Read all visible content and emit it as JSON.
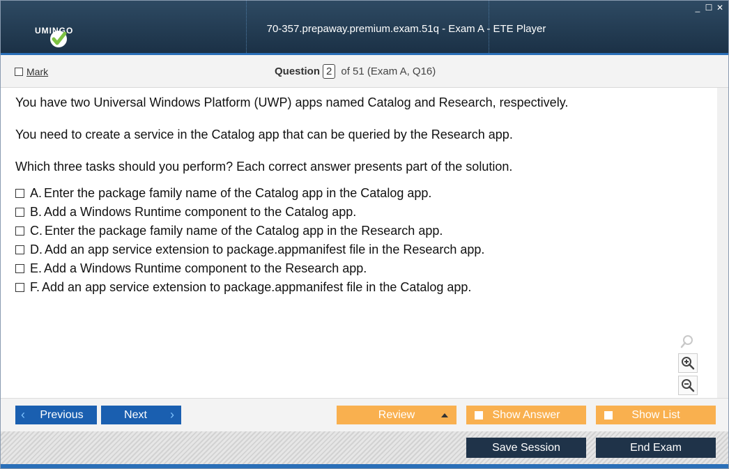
{
  "window": {
    "title": "70-357.prepaway.premium.exam.51q - Exam A - ETE Player",
    "logo_text": "UMINGO",
    "controls": [
      "_",
      "☐",
      "✕"
    ]
  },
  "header": {
    "mark_label": "Mark",
    "question_word": "Question",
    "question_number": "2",
    "question_of": "of 51 (Exam A, Q16)"
  },
  "question": {
    "paragraphs": [
      "You have two Universal Windows Platform (UWP) apps named Catalog and Research, respectively.",
      "You need to create a service in the Catalog app that can be queried by the Research app.",
      "Which three tasks should you perform? Each correct answer presents part of the solution."
    ],
    "options": [
      {
        "letter": "A.",
        "text": "Enter the package family name of the Catalog app in the Catalog app."
      },
      {
        "letter": "B.",
        "text": "Add a Windows Runtime component to the Catalog app."
      },
      {
        "letter": "C.",
        "text": "Enter the package family name of the Catalog app in the Research app."
      },
      {
        "letter": "D.",
        "text": "Add an app service extension to package.appmanifest file in the Research app."
      },
      {
        "letter": "E.",
        "text": "Add a Windows Runtime component to the Research app."
      },
      {
        "letter": "F.",
        "text": "Add an app service extension to package.appmanifest file in the Catalog app."
      }
    ]
  },
  "nav": {
    "previous": "Previous",
    "next": "Next",
    "review": "Review",
    "show_answer": "Show Answer",
    "show_list": "Show List",
    "save_session": "Save Session",
    "end_exam": "End Exam"
  },
  "colors": {
    "titlebar": "#1b3146",
    "accent_blue": "#1a5fb0",
    "orange": "#f9b04f",
    "dark_button": "#1f3349",
    "logo_green": "#7dc242"
  },
  "icons": {
    "zoom_reset": "magnifier-icon",
    "zoom_in": "zoom-in-icon",
    "zoom_out": "zoom-out-icon"
  }
}
